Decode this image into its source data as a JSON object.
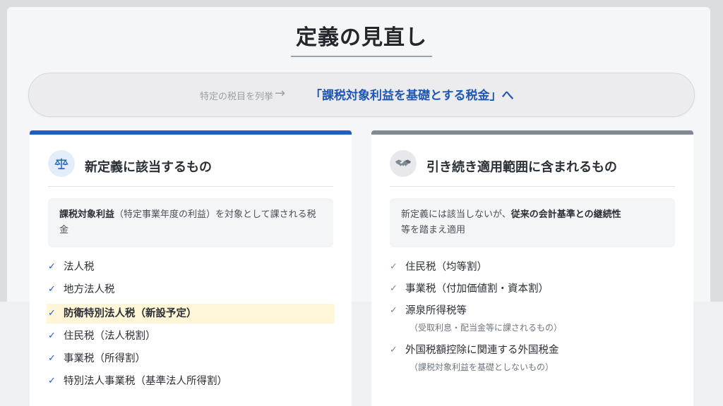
{
  "title": "定義の見直し",
  "banner": {
    "old": "特定の税目を列挙",
    "arrow": "→",
    "new": "「課税対象利益を基礎とする税金」へ"
  },
  "left": {
    "heading": "新定義に該当するもの",
    "icon": "scale-icon",
    "desc": {
      "bold": "課税対象利益",
      "rest": "（特定事業年度の利益）を対象として課される税金"
    },
    "items": [
      {
        "label": "法人税"
      },
      {
        "label": "地方法人税"
      },
      {
        "label": "防衛特別法人税（新設予定）",
        "highlight": true
      },
      {
        "label": "住民税（法人税割）"
      },
      {
        "label": "事業税（所得割）"
      },
      {
        "label": "特別法人事業税（基準法人所得割）"
      }
    ]
  },
  "right": {
    "heading": "引き続き適用範囲に含まれるもの",
    "icon": "handshake-icon",
    "desc": {
      "pre": "新定義には該当しないが、",
      "bold": "従来の会計基準との継続性",
      "post": "等を踏まえ適用"
    },
    "items": [
      {
        "label": "住民税（均等割）"
      },
      {
        "label": "事業税（付加価値割・資本割）"
      },
      {
        "label": "源泉所得税等",
        "sub": "（受取利息・配当金等に課されるもの）"
      },
      {
        "label": "外国税額控除に関連する外国税金",
        "sub": "（課税対象利益を基礎としないもの）"
      }
    ]
  },
  "colors": {
    "accent_blue": "#1f5fc4",
    "accent_gray": "#7f8a94",
    "highlight": "#fff6d8"
  }
}
